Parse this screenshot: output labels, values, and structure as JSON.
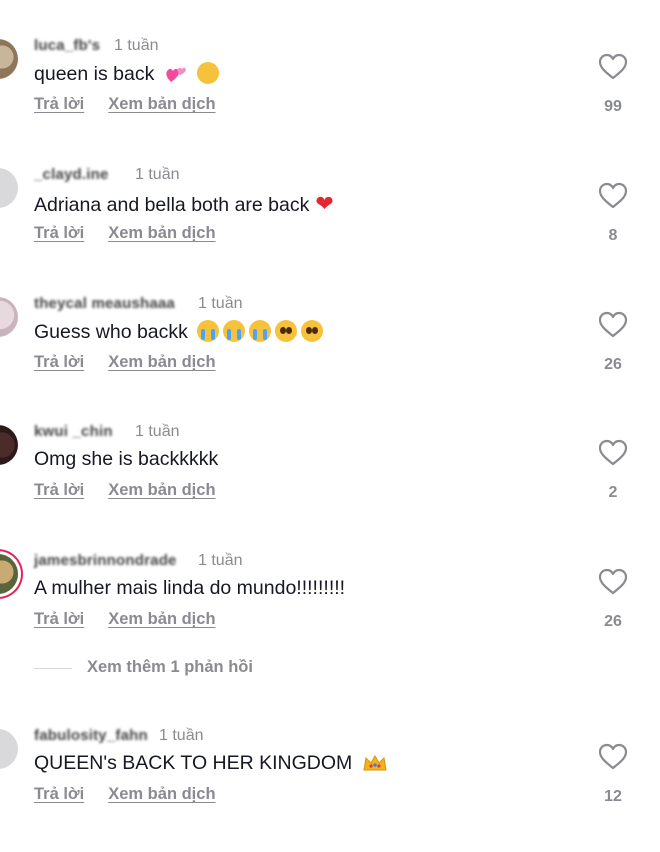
{
  "comments": [
    {
      "username": "luca_fb's",
      "time": "1 tuần",
      "text": "queen is back",
      "likes": "99"
    },
    {
      "username": "_clayd.ine",
      "time": "1 tuần",
      "text": "Adriana and bella both are back",
      "likes": "8"
    },
    {
      "username": "theycal meaushaaa",
      "time": "1 tuần",
      "text": "Guess who backk",
      "likes": "26"
    },
    {
      "username": "kwui _chin",
      "time": "1 tuần",
      "text": "Omg she is backkkkk",
      "likes": "2"
    },
    {
      "username": "jamesbrinnondrade",
      "time": "1 tuần",
      "text": "A mulher mais linda do mundo!!!!!!!!!",
      "likes": "26"
    },
    {
      "username": "fabulosity_fahn",
      "time": "1 tuần",
      "text": "QUEEN's BACK TO HER KINGDOM",
      "likes": "12"
    }
  ],
  "actions": {
    "reply": "Trả lời",
    "translate": "Xem bản dịch"
  },
  "more_replies": "Xem thêm 1 phản hồi",
  "icons": {
    "like": "heart-outline-icon"
  }
}
